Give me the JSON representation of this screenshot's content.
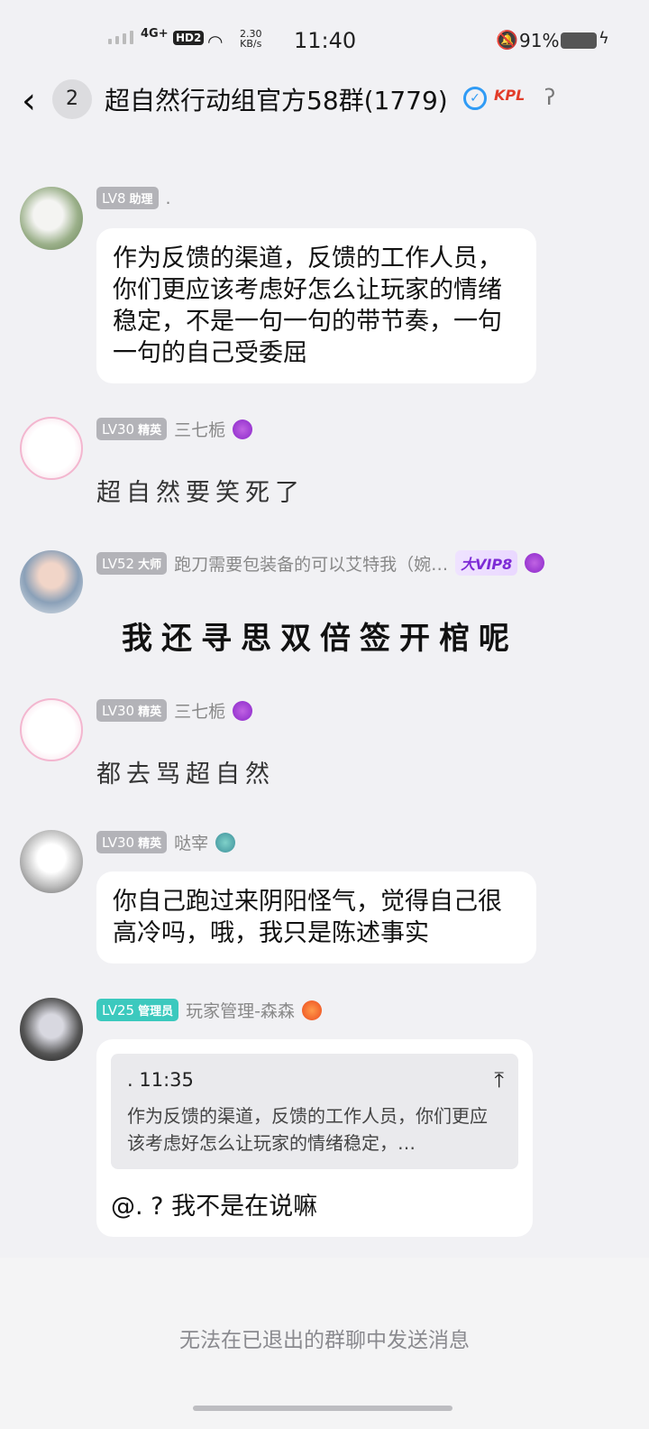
{
  "status": {
    "network": "4G+",
    "hd": "HD2",
    "speed_value": "2.30",
    "speed_unit": "KB/s",
    "time": "11:40",
    "battery": "91%"
  },
  "header": {
    "unread_count": "2",
    "title": "超自然行动组官方58群(1779)"
  },
  "messages": [
    {
      "level": "LV8",
      "role": "助理",
      "name": ".",
      "text": "作为反馈的渠道，反馈的工作人员，你们更应该考虑好怎么让玩家的情绪稳定，不是一句一句的带节奏，一句一句的自己受委屈"
    },
    {
      "level": "LV30",
      "role": "精英",
      "name": "三七栀",
      "sticker": "超自然要笑死了"
    },
    {
      "level": "LV52",
      "role": "大师",
      "name": "跑刀需要包装备的可以艾特我（婉…",
      "vip": "大VIP8",
      "sticker": "我还寻思双倍签开棺呢"
    },
    {
      "level": "LV30",
      "role": "精英",
      "name": "三七栀",
      "sticker": "都去骂超自然"
    },
    {
      "level": "LV30",
      "role": "精英",
      "name": "哒宰",
      "text": "你自己跑过来阴阳怪气，觉得自己很高冷吗，哦，我只是陈述事实"
    },
    {
      "level": "LV25",
      "role": "管理员",
      "name": "玩家管理-森森",
      "quote_time": ". 11:35",
      "quote_text": "作为反馈的渠道，反馈的工作人员，你们更应该考虑好怎么让玩家的情绪稳定，…",
      "text": "@. ? 我不是在说嘛"
    }
  ],
  "footer": {
    "notice": "无法在已退出的群聊中发送消息"
  }
}
